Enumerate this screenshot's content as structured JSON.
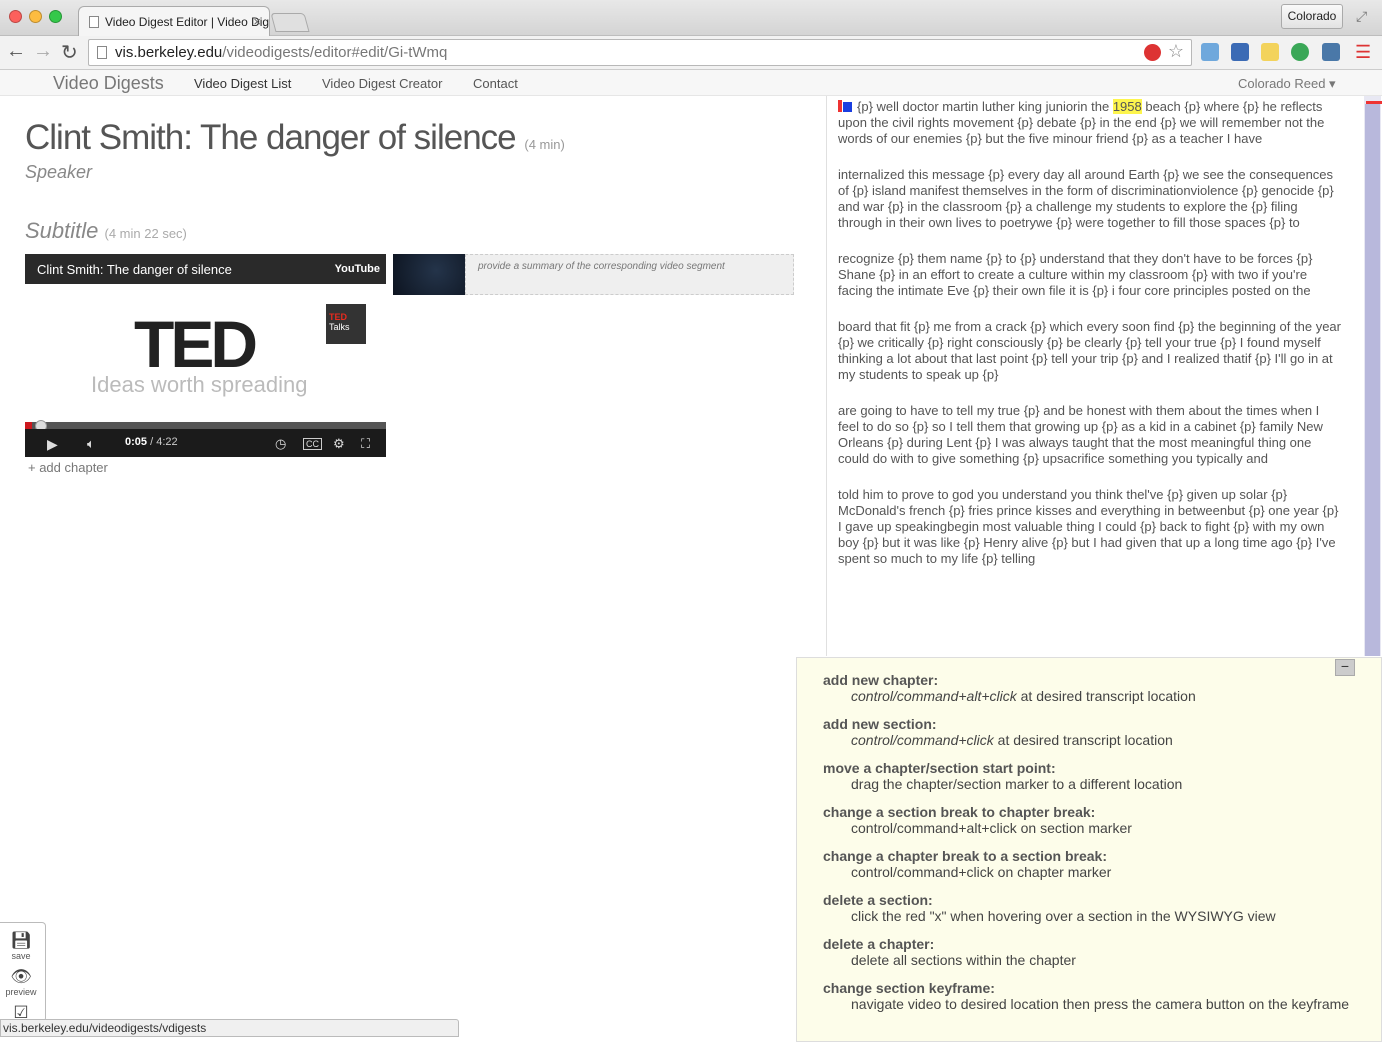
{
  "browser": {
    "tab_title": "Video Digest Editor | Video Digests",
    "tab_close": "×",
    "profile_name": "Colorado",
    "url_host": "vis.berkeley.edu",
    "url_path": "/videodigests/editor#edit/Gi-tWmq",
    "status_url": "vis.berkeley.edu/videodigests/vdigests"
  },
  "nav": {
    "brand": "Video Digests",
    "links": [
      "Video Digest List",
      "Video Digest Creator",
      "Contact"
    ],
    "user": "Colorado Reed ▾"
  },
  "video": {
    "title": "Clint Smith: The danger of silence",
    "duration": "(4 min)",
    "speaker": "Speaker",
    "subtitle": "Subtitle",
    "subtitle_duration": "(4 min 22 sec)"
  },
  "player": {
    "title": "Clint Smith: The danger of silence",
    "source": "YouTube",
    "logo": "TED",
    "badge_ted": "TED",
    "badge_talks": "Talks",
    "tagline": "Ideas worth spreading",
    "time_current": "0:05",
    "time_total": " / 4:22",
    "progress": 0.02
  },
  "segment": {
    "summary_placeholder": "provide a summary of the corresponding video segment"
  },
  "add_chapter": "+ add chapter",
  "transcript": {
    "p1_before": "{p} well doctor martin luther king juniorin the ",
    "p1_highlight": "1958",
    "p1_after": " beach {p} where {p} he reflects upon the civil rights movement {p} debate {p} in the end {p} we will remember not the words of our enemies {p} but the five minour friend {p} as a teacher I have",
    "paragraphs": [
      "internalized this message {p} every day all around Earth {p} we see the consequences of {p} island manifest themselves in the form of discriminationviolence {p} genocide {p} and war {p} in the classroom {p} a challenge my students to explore the {p} filing through in their own lives to poetrywe {p} were together to fill those spaces {p} to",
      "recognize {p} them name {p} to {p} understand that they don't have to be forces {p} Shane {p} in an effort to create a culture within my classroom {p} with two if you're facing the intimate Eve {p} their own file it is {p} i four core principles posted on the",
      "board that fit {p} me from a crack {p} which every soon find {p} the beginning of the year {p} we critically {p} right consciously {p} be clearly {p} tell your true {p} I found myself thinking a lot about that last point {p} tell your trip {p} and I realized thatif {p} I'll go in at my students to speak up {p}",
      "are going to have to tell my true {p} and be honest with them about the times when I feel to do so {p} so I tell them that growing up {p} as a kid in a cabinet {p} family New Orleans {p} during Lent {p} I was always taught that the most meaningful thing one could do with to give something {p} upsacrifice something you typically and",
      "told him to prove to god you understand you think thel've {p} given up solar {p} McDonald's french {p} fries prince kisses and everything in betweenbut {p} one year {p} I gave up speakingbegin most valuable thing I could {p} back to fight {p} with my own boy {p} but it was like {p} Henry alive {p} but I had given that up a long time ago {p} I've spent so much to my life {p} telling"
    ]
  },
  "help": {
    "collapse": "−",
    "items": [
      {
        "term": "add new chapter:",
        "desc_em": "control/command+alt+click",
        "desc": " at desired transcript location"
      },
      {
        "term": "add new section:",
        "desc_em": "control/command+click",
        "desc": " at desired transcript location"
      },
      {
        "term": "move a chapter/section start point:",
        "desc_em": "",
        "desc": "drag the chapter/section marker to a different location"
      },
      {
        "term": "change a section break to chapter break:",
        "desc_em": "",
        "desc": "control/command+alt+click on section marker"
      },
      {
        "term": "change a chapter break to a section break:",
        "desc_em": "",
        "desc": "control/command+click on chapter marker"
      },
      {
        "term": "delete a section:",
        "desc_em": "",
        "desc": "click the red \"x\" when hovering over a section in the WYSIWYG view"
      },
      {
        "term": "delete a chapter:",
        "desc_em": "",
        "desc": "delete all sections within the chapter"
      },
      {
        "term": "change section keyframe:",
        "desc_em": "",
        "desc": "navigate video to desired location then press the camera button on the keyframe"
      }
    ]
  },
  "tools": {
    "save": "save",
    "preview": "preview"
  },
  "colors": {
    "highlight": "#fdf54d",
    "chapter_marker": "#e33333",
    "section_marker": "#1a3ee0",
    "help_bg": "#fdfdea"
  }
}
